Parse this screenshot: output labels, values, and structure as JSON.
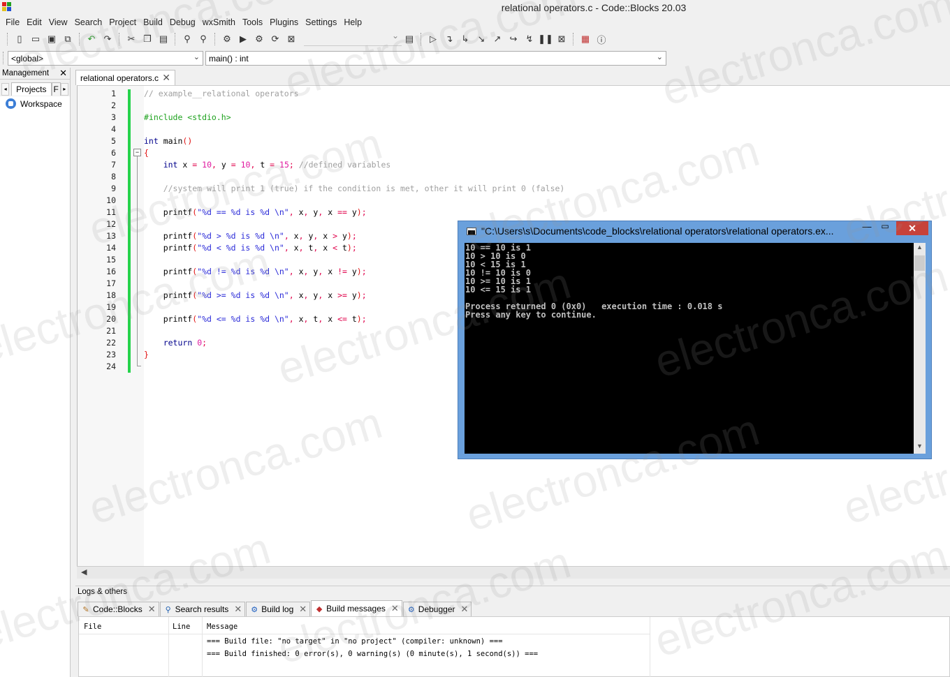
{
  "window": {
    "title": "relational operators.c - Code::Blocks 20.03"
  },
  "menu": [
    "File",
    "Edit",
    "View",
    "Search",
    "Project",
    "Build",
    "Debug",
    "wxSmith",
    "Tools",
    "Plugins",
    "Settings",
    "Help"
  ],
  "scope": {
    "global": "<global>",
    "function": "main() : int"
  },
  "management": {
    "title": "Management",
    "tab_projects": "Projects",
    "tab_next": "F",
    "workspace": "Workspace"
  },
  "editor": {
    "tab_label": "relational operators.c",
    "lines": [
      {
        "n": "1",
        "segs": [
          [
            "cm",
            "// example__relational operators"
          ]
        ]
      },
      {
        "n": "2",
        "segs": []
      },
      {
        "n": "3",
        "segs": [
          [
            "pp",
            "#include <stdio.h>"
          ]
        ]
      },
      {
        "n": "4",
        "segs": []
      },
      {
        "n": "5",
        "segs": [
          [
            "kw",
            "int"
          ],
          [
            "tx",
            " main"
          ],
          [
            "br",
            "()"
          ]
        ]
      },
      {
        "n": "6",
        "segs": [
          [
            "br",
            "{"
          ]
        ]
      },
      {
        "n": "7",
        "segs": [
          [
            "tx",
            "    "
          ],
          [
            "kw",
            "int"
          ],
          [
            "tx",
            " x "
          ],
          [
            "op",
            "="
          ],
          [
            "tx",
            " "
          ],
          [
            "num",
            "10"
          ],
          [
            "op",
            ","
          ],
          [
            "tx",
            " y "
          ],
          [
            "op",
            "="
          ],
          [
            "tx",
            " "
          ],
          [
            "num",
            "10"
          ],
          [
            "op",
            ","
          ],
          [
            "tx",
            " t "
          ],
          [
            "op",
            "="
          ],
          [
            "tx",
            " "
          ],
          [
            "num",
            "15"
          ],
          [
            "op",
            ";"
          ],
          [
            "tx",
            " "
          ],
          [
            "cm",
            "//defined variables"
          ]
        ]
      },
      {
        "n": "8",
        "segs": []
      },
      {
        "n": "9",
        "segs": [
          [
            "tx",
            "    "
          ],
          [
            "cm",
            "//system will print 1 (true) if the condition is met, other it will print 0 (false)"
          ]
        ]
      },
      {
        "n": "10",
        "segs": []
      },
      {
        "n": "11",
        "segs": [
          [
            "tx",
            "    printf"
          ],
          [
            "br",
            "("
          ],
          [
            "str",
            "\"%d == %d is %d \\n\""
          ],
          [
            "op",
            ","
          ],
          [
            "tx",
            " x"
          ],
          [
            "op",
            ","
          ],
          [
            "tx",
            " y"
          ],
          [
            "op",
            ","
          ],
          [
            "tx",
            " x "
          ],
          [
            "op",
            "=="
          ],
          [
            "tx",
            " y"
          ],
          [
            "br",
            ")"
          ],
          [
            "op",
            ";"
          ]
        ]
      },
      {
        "n": "12",
        "segs": []
      },
      {
        "n": "13",
        "segs": [
          [
            "tx",
            "    printf"
          ],
          [
            "br",
            "("
          ],
          [
            "str",
            "\"%d > %d is %d \\n\""
          ],
          [
            "op",
            ","
          ],
          [
            "tx",
            " x"
          ],
          [
            "op",
            ","
          ],
          [
            "tx",
            " y"
          ],
          [
            "op",
            ","
          ],
          [
            "tx",
            " x "
          ],
          [
            "op",
            ">"
          ],
          [
            "tx",
            " y"
          ],
          [
            "br",
            ")"
          ],
          [
            "op",
            ";"
          ]
        ]
      },
      {
        "n": "14",
        "segs": [
          [
            "tx",
            "    printf"
          ],
          [
            "br",
            "("
          ],
          [
            "str",
            "\"%d < %d is %d \\n\""
          ],
          [
            "op",
            ","
          ],
          [
            "tx",
            " x"
          ],
          [
            "op",
            ","
          ],
          [
            "tx",
            " t"
          ],
          [
            "op",
            ","
          ],
          [
            "tx",
            " x "
          ],
          [
            "op",
            "<"
          ],
          [
            "tx",
            " t"
          ],
          [
            "br",
            ")"
          ],
          [
            "op",
            ";"
          ]
        ]
      },
      {
        "n": "15",
        "segs": []
      },
      {
        "n": "16",
        "segs": [
          [
            "tx",
            "    printf"
          ],
          [
            "br",
            "("
          ],
          [
            "str",
            "\"%d != %d is %d \\n\""
          ],
          [
            "op",
            ","
          ],
          [
            "tx",
            " x"
          ],
          [
            "op",
            ","
          ],
          [
            "tx",
            " y"
          ],
          [
            "op",
            ","
          ],
          [
            "tx",
            " x "
          ],
          [
            "op",
            "!="
          ],
          [
            "tx",
            " y"
          ],
          [
            "br",
            ")"
          ],
          [
            "op",
            ";"
          ]
        ]
      },
      {
        "n": "17",
        "segs": []
      },
      {
        "n": "18",
        "segs": [
          [
            "tx",
            "    printf"
          ],
          [
            "br",
            "("
          ],
          [
            "str",
            "\"%d >= %d is %d \\n\""
          ],
          [
            "op",
            ","
          ],
          [
            "tx",
            " x"
          ],
          [
            "op",
            ","
          ],
          [
            "tx",
            " y"
          ],
          [
            "op",
            ","
          ],
          [
            "tx",
            " x "
          ],
          [
            "op",
            ">="
          ],
          [
            "tx",
            " y"
          ],
          [
            "br",
            ")"
          ],
          [
            "op",
            ";"
          ]
        ]
      },
      {
        "n": "19",
        "segs": []
      },
      {
        "n": "20",
        "segs": [
          [
            "tx",
            "    printf"
          ],
          [
            "br",
            "("
          ],
          [
            "str",
            "\"%d <= %d is %d \\n\""
          ],
          [
            "op",
            ","
          ],
          [
            "tx",
            " x"
          ],
          [
            "op",
            ","
          ],
          [
            "tx",
            " t"
          ],
          [
            "op",
            ","
          ],
          [
            "tx",
            " x "
          ],
          [
            "op",
            "<="
          ],
          [
            "tx",
            " t"
          ],
          [
            "br",
            ")"
          ],
          [
            "op",
            ";"
          ]
        ]
      },
      {
        "n": "21",
        "segs": []
      },
      {
        "n": "22",
        "segs": [
          [
            "tx",
            "    "
          ],
          [
            "kw",
            "return"
          ],
          [
            "tx",
            " "
          ],
          [
            "num",
            "0"
          ],
          [
            "op",
            ";"
          ]
        ]
      },
      {
        "n": "23",
        "segs": [
          [
            "br",
            "}"
          ]
        ]
      },
      {
        "n": "24",
        "segs": []
      }
    ]
  },
  "console": {
    "title": "\"C:\\Users\\s\\Documents\\code_blocks\\relational operators\\relational operators.ex...",
    "output": "10 == 10 is 1\n10 > 10 is 0\n10 < 15 is 1\n10 != 10 is 0\n10 >= 10 is 1\n10 <= 15 is 1\n\nProcess returned 0 (0x0)   execution time : 0.018 s\nPress any key to continue."
  },
  "logs": {
    "title": "Logs & others",
    "tabs": [
      {
        "label": "Code::Blocks",
        "icon": "pencil-icon"
      },
      {
        "label": "Search results",
        "icon": "magnifier-icon"
      },
      {
        "label": "Build log",
        "icon": "gear-icon"
      },
      {
        "label": "Build messages",
        "icon": "marker-icon"
      },
      {
        "label": "Debugger",
        "icon": "gear-icon"
      }
    ],
    "columns": {
      "file": "File",
      "line": "Line",
      "message": "Message"
    },
    "messages": [
      "=== Build file: \"no target\" in \"no project\" (compiler: unknown) ===",
      "=== Build finished: 0 error(s), 0 warning(s) (0 minute(s), 1 second(s)) ==="
    ]
  },
  "watermark": "electronca.com",
  "colors": {
    "change_bar": "#26d34c",
    "console_frame": "#6aa0dc",
    "close_button": "#c7423a"
  }
}
